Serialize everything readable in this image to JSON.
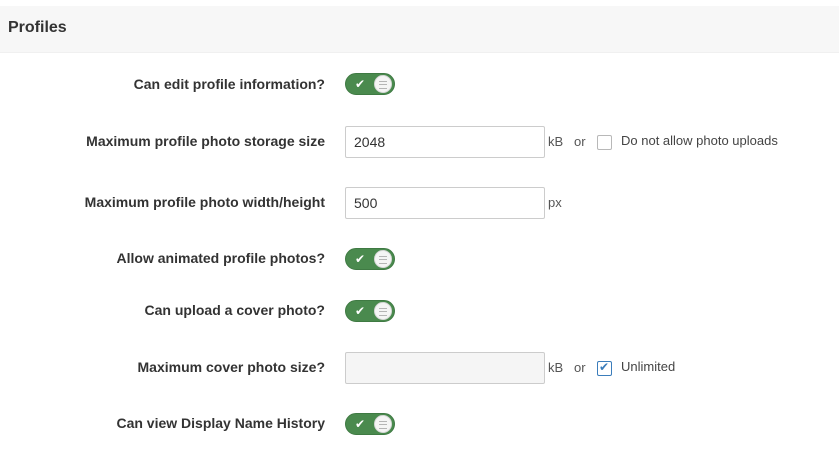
{
  "header": {
    "title": "Profiles"
  },
  "settings": {
    "edit_profile": {
      "label": "Can edit profile information?",
      "value": true,
      "icon": "check-icon"
    },
    "photo_storage": {
      "label": "Maximum profile photo storage size",
      "value": "2048",
      "unit": "kB",
      "or": "or",
      "checkbox_label": "Do not allow photo uploads",
      "checkbox_checked": false
    },
    "photo_dimensions": {
      "label": "Maximum profile photo width/height",
      "value": "500",
      "unit": "px"
    },
    "animated_photos": {
      "label": "Allow animated profile photos?",
      "value": true
    },
    "cover_photo": {
      "label": "Can upload a cover photo?",
      "value": true
    },
    "cover_size": {
      "label": "Maximum cover photo size?",
      "value": "",
      "unit": "kB",
      "or": "or",
      "checkbox_label": "Unlimited",
      "checkbox_checked": true
    },
    "display_name_history": {
      "label": "Can view Display Name History",
      "value": true
    }
  },
  "colors": {
    "toggle_on": "#4a8a4e",
    "checkbox_accent": "#3b7dbb",
    "header_bg": "#f7f7f7"
  }
}
